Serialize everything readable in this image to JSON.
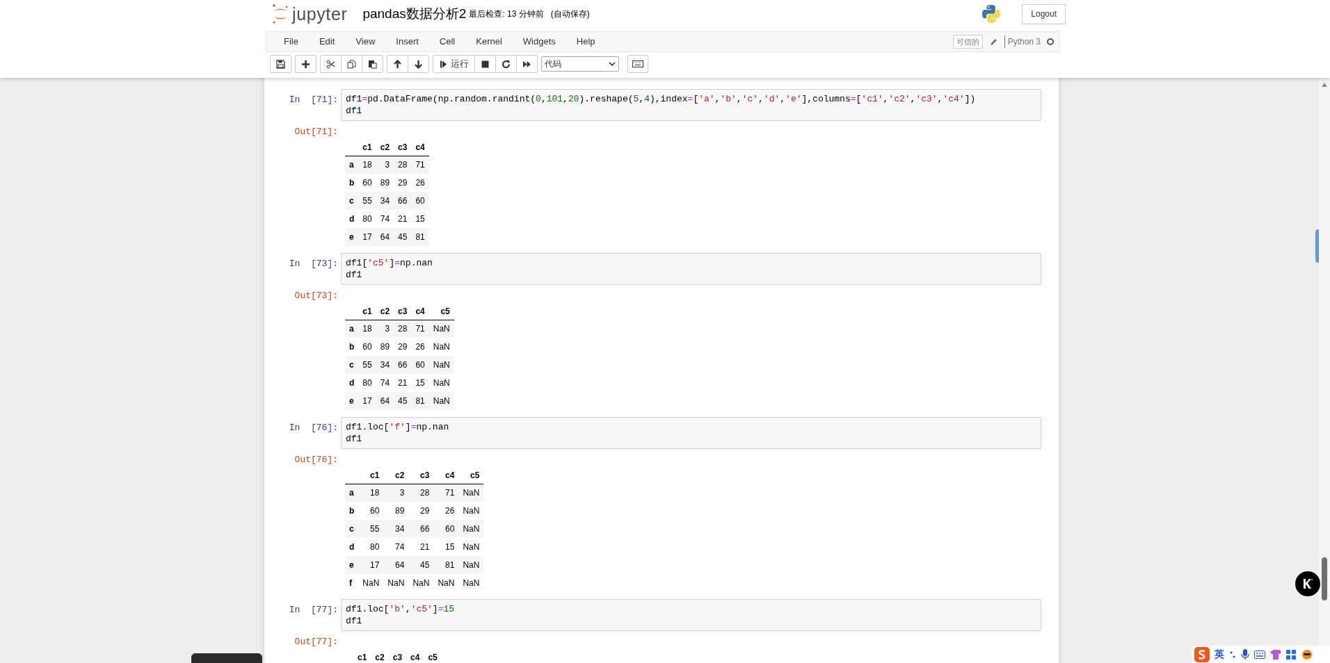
{
  "header": {
    "logo_text": "jupyter",
    "notebook_name": "pandas数据分析2",
    "checkpoint": "最后检查: 13 分钟前",
    "autosave": "(自动保存)",
    "logout": "Logout"
  },
  "menu": [
    "File",
    "Edit",
    "View",
    "Insert",
    "Cell",
    "Kernel",
    "Widgets",
    "Help"
  ],
  "kernel": {
    "trusted": "可信的",
    "name": "Python 3",
    "busy": false
  },
  "toolbar": {
    "groups": [
      [
        {
          "kind": "save"
        }
      ],
      [
        {
          "kind": "add"
        }
      ],
      [
        {
          "kind": "cut"
        },
        {
          "kind": "copy"
        },
        {
          "kind": "paste"
        }
      ],
      [
        {
          "kind": "up"
        },
        {
          "kind": "down"
        }
      ],
      [
        {
          "kind": "run",
          "label": "运行"
        },
        {
          "kind": "stop"
        },
        {
          "kind": "restart"
        },
        {
          "kind": "fastforward"
        }
      ]
    ],
    "cell_type": "代码"
  },
  "cells": [
    {
      "prompt_in": "In  [71]:",
      "code": [
        [
          {
            "text": "df1",
            "kind": "plain"
          },
          {
            "text": "=",
            "kind": "op"
          },
          {
            "text": "pd.DataFrame(np.random.randint(",
            "kind": "plain"
          },
          {
            "text": "0",
            "kind": "num"
          },
          {
            "text": ",",
            "kind": "plain"
          },
          {
            "text": "101",
            "kind": "num"
          },
          {
            "text": ",",
            "kind": "plain"
          },
          {
            "text": "20",
            "kind": "num"
          },
          {
            "text": ").reshape(",
            "kind": "plain"
          },
          {
            "text": "5",
            "kind": "num"
          },
          {
            "text": ",",
            "kind": "plain"
          },
          {
            "text": "4",
            "kind": "num"
          },
          {
            "text": "),index",
            "kind": "plain"
          },
          {
            "text": "=",
            "kind": "op"
          },
          {
            "text": "[",
            "kind": "plain"
          },
          {
            "text": "'a'",
            "kind": "str"
          },
          {
            "text": ",",
            "kind": "plain"
          },
          {
            "text": "'b'",
            "kind": "str"
          },
          {
            "text": ",",
            "kind": "plain"
          },
          {
            "text": "'c'",
            "kind": "str"
          },
          {
            "text": ",",
            "kind": "plain"
          },
          {
            "text": "'d'",
            "kind": "str"
          },
          {
            "text": ",",
            "kind": "plain"
          },
          {
            "text": "'e'",
            "kind": "str"
          },
          {
            "text": "],columns",
            "kind": "plain"
          },
          {
            "text": "=",
            "kind": "op"
          },
          {
            "text": "[",
            "kind": "plain"
          },
          {
            "text": "'c1'",
            "kind": "str"
          },
          {
            "text": ",",
            "kind": "plain"
          },
          {
            "text": "'c2'",
            "kind": "str"
          },
          {
            "text": ",",
            "kind": "plain"
          },
          {
            "text": "'c3'",
            "kind": "str"
          },
          {
            "text": ",",
            "kind": "plain"
          },
          {
            "text": "'c4'",
            "kind": "str"
          },
          {
            "text": "])",
            "kind": "plain"
          }
        ],
        [
          {
            "text": "df1",
            "kind": "plain"
          }
        ]
      ],
      "prompt_out": "Out[71]:",
      "table": {
        "columns": [
          "c1",
          "c2",
          "c3",
          "c4"
        ],
        "rows": [
          {
            "index": "a",
            "values": [
              "18",
              "3",
              "28",
              "71"
            ]
          },
          {
            "index": "b",
            "values": [
              "60",
              "89",
              "29",
              "26"
            ]
          },
          {
            "index": "c",
            "values": [
              "55",
              "34",
              "66",
              "60"
            ]
          },
          {
            "index": "d",
            "values": [
              "80",
              "74",
              "21",
              "15"
            ]
          },
          {
            "index": "e",
            "values": [
              "17",
              "64",
              "45",
              "81"
            ]
          }
        ]
      }
    },
    {
      "prompt_in": "In  [73]:",
      "code": [
        [
          {
            "text": "df1[",
            "kind": "plain"
          },
          {
            "text": "'c5'",
            "kind": "str"
          },
          {
            "text": "]",
            "kind": "plain"
          },
          {
            "text": "=",
            "kind": "op"
          },
          {
            "text": "np.nan",
            "kind": "plain"
          }
        ],
        [
          {
            "text": "df1",
            "kind": "plain"
          }
        ]
      ],
      "prompt_out": "Out[73]:",
      "table": {
        "columns": [
          "c1",
          "c2",
          "c3",
          "c4",
          "c5"
        ],
        "rows": [
          {
            "index": "a",
            "values": [
              "18",
              "3",
              "28",
              "71",
              "NaN"
            ]
          },
          {
            "index": "b",
            "values": [
              "60",
              "89",
              "29",
              "26",
              "NaN"
            ]
          },
          {
            "index": "c",
            "values": [
              "55",
              "34",
              "66",
              "60",
              "NaN"
            ]
          },
          {
            "index": "d",
            "values": [
              "80",
              "74",
              "21",
              "15",
              "NaN"
            ]
          },
          {
            "index": "e",
            "values": [
              "17",
              "64",
              "45",
              "81",
              "NaN"
            ]
          }
        ]
      }
    },
    {
      "prompt_in": "In  [76]:",
      "code": [
        [
          {
            "text": "df1.loc[",
            "kind": "plain"
          },
          {
            "text": "'f'",
            "kind": "str"
          },
          {
            "text": "]",
            "kind": "plain"
          },
          {
            "text": "=",
            "kind": "op"
          },
          {
            "text": "np.nan",
            "kind": "plain"
          }
        ],
        [
          {
            "text": "df1",
            "kind": "plain"
          }
        ]
      ],
      "prompt_out": "Out[76]:",
      "table": {
        "columns": [
          "c1",
          "c2",
          "c3",
          "c4",
          "c5"
        ],
        "rows": [
          {
            "index": "a",
            "values": [
              "18",
              "3",
              "28",
              "71",
              "NaN"
            ]
          },
          {
            "index": "b",
            "values": [
              "60",
              "89",
              "29",
              "26",
              "NaN"
            ]
          },
          {
            "index": "c",
            "values": [
              "55",
              "34",
              "66",
              "60",
              "NaN"
            ]
          },
          {
            "index": "d",
            "values": [
              "80",
              "74",
              "21",
              "15",
              "NaN"
            ]
          },
          {
            "index": "e",
            "values": [
              "17",
              "64",
              "45",
              "81",
              "NaN"
            ]
          },
          {
            "index": "f",
            "values": [
              "NaN",
              "NaN",
              "NaN",
              "NaN",
              "NaN"
            ]
          }
        ]
      }
    },
    {
      "prompt_in": "In  [77]:",
      "code": [
        [
          {
            "text": "df1.loc[",
            "kind": "plain"
          },
          {
            "text": "'b'",
            "kind": "str"
          },
          {
            "text": ",",
            "kind": "plain"
          },
          {
            "text": "'c5'",
            "kind": "str"
          },
          {
            "text": "]",
            "kind": "plain"
          },
          {
            "text": "=",
            "kind": "op"
          },
          {
            "text": "15",
            "kind": "num"
          }
        ],
        [
          {
            "text": "df1",
            "kind": "plain"
          }
        ]
      ],
      "prompt_out": "Out[77]:",
      "table": {
        "columns": [
          "c1",
          "c2",
          "c3",
          "c4",
          "c5"
        ]
      }
    }
  ],
  "ime": {
    "label": "英"
  }
}
